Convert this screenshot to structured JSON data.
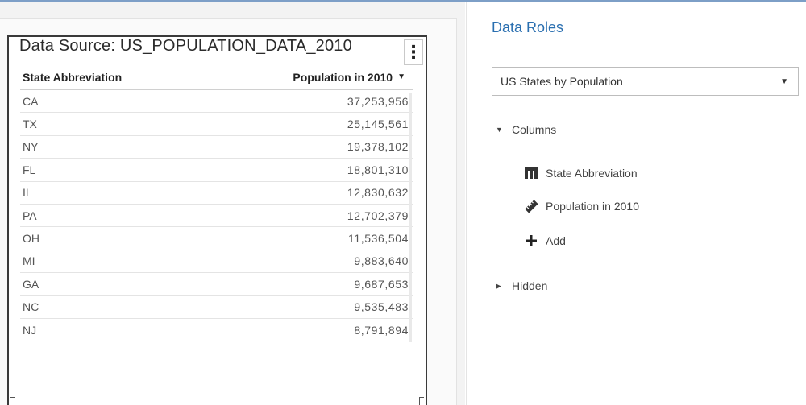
{
  "report": {
    "title": "Data Source: US_POPULATION_DATA_2010",
    "drag_glyph": ":::",
    "menu_glyph": "⋮",
    "columns": {
      "left": "State Abbreviation",
      "right": "Population in 2010",
      "sort_glyph": "▼"
    },
    "rows": [
      {
        "state": "CA",
        "population": "37,253,956"
      },
      {
        "state": "TX",
        "population": "25,145,561"
      },
      {
        "state": "NY",
        "population": "19,378,102"
      },
      {
        "state": "FL",
        "population": "18,801,310"
      },
      {
        "state": "IL",
        "population": "12,830,632"
      },
      {
        "state": "PA",
        "population": "12,702,379"
      },
      {
        "state": "OH",
        "population": "11,536,504"
      },
      {
        "state": "MI",
        "population": "9,883,640"
      },
      {
        "state": "GA",
        "population": "9,687,653"
      },
      {
        "state": "NC",
        "population": "9,535,483"
      },
      {
        "state": "NJ",
        "population": "8,791,894"
      }
    ]
  },
  "panel": {
    "title": "Data Roles",
    "dropdown": {
      "value": "US States by Population",
      "arrow": "▼"
    },
    "columns_section": {
      "label": "Columns",
      "expanded_glyph": "▼"
    },
    "column_items": [
      {
        "label": "State Abbreviation",
        "icon": "category-icon"
      },
      {
        "label": "Population in 2010",
        "icon": "measure-ruler-icon"
      },
      {
        "label": "Add",
        "icon": "plus-icon"
      }
    ],
    "hidden_section": {
      "label": "Hidden",
      "collapsed_glyph": "▶"
    }
  },
  "colors": {
    "accent": "#2a6fb0",
    "border_top": "#7d9fc7"
  }
}
